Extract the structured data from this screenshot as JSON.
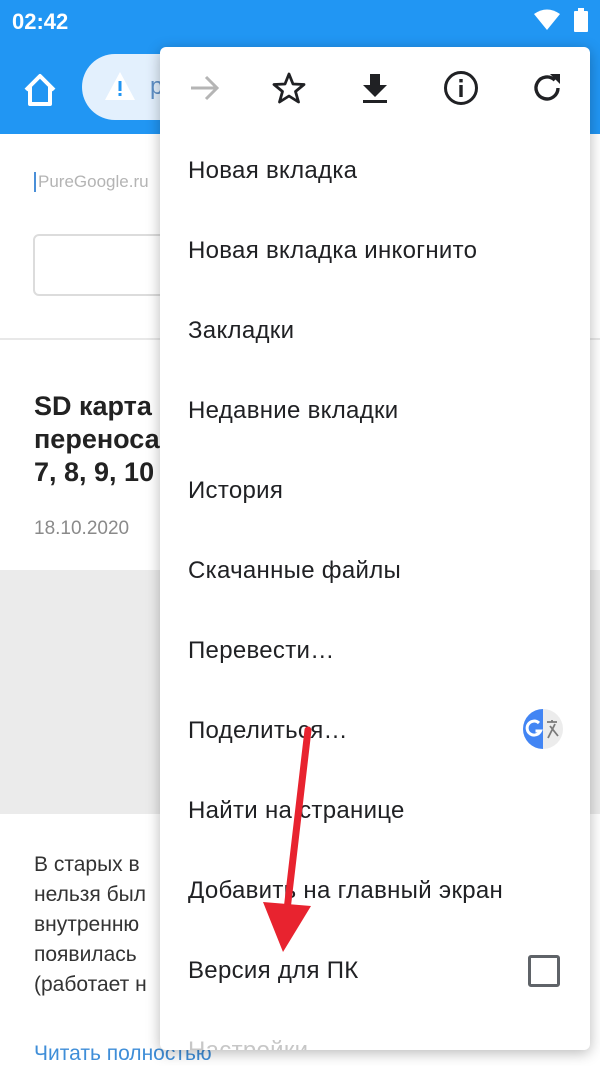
{
  "status_bar": {
    "time": "02:42"
  },
  "toolbar": {
    "url_text": "p"
  },
  "page": {
    "logo_text": "PureGoogle.ru",
    "article_title": "SD карта\nпереноса\n7, 8, 9, 10",
    "date": "18.10.2020",
    "excerpt": "В старых в\nнельзя был\nвнутренню\nпоявилась\n(работает н",
    "read_more": "Читать полностью"
  },
  "menu": {
    "items": [
      "Новая вкладка",
      "Новая вкладка инкогнито",
      "Закладки",
      "Недавние вкладки",
      "История",
      "Скачанные файлы",
      "Перевести…",
      "Поделиться…",
      "Найти на странице",
      "Добавить на главный экран",
      "Версия для ПК",
      "Настройки"
    ],
    "desktop_version_checked": false
  },
  "colors": {
    "toolbar_blue": "#2196f3",
    "arrow_red": "#e8232f",
    "link_blue": "#3f8ed8"
  }
}
